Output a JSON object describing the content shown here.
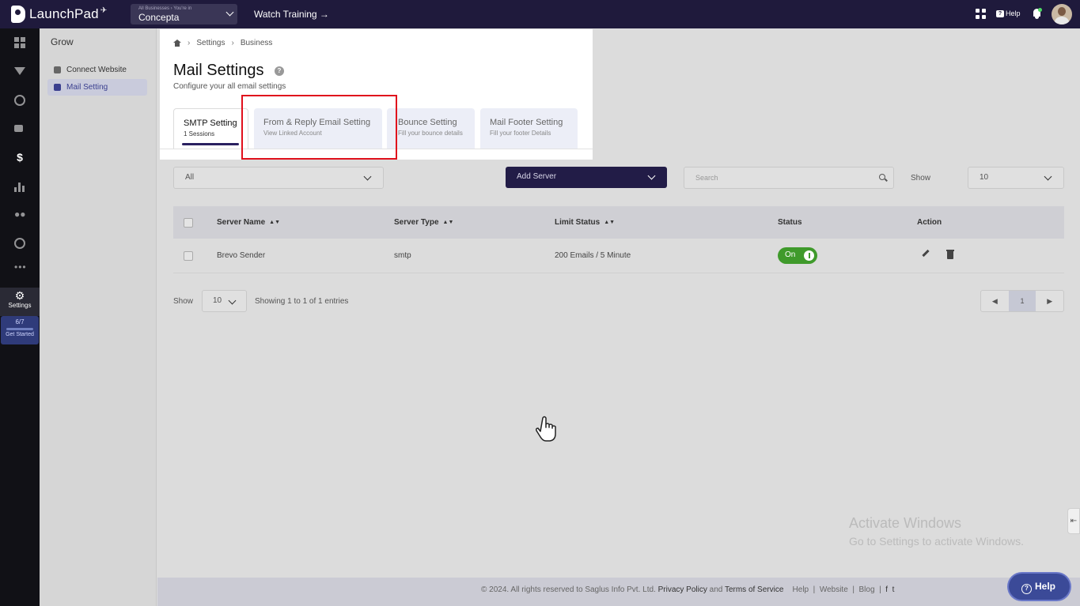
{
  "topbar": {
    "app_name": "LaunchPad",
    "business_caption": "All Businesses › You're in",
    "business_name": "Concepta",
    "watch_training": "Watch Training →",
    "help_label": "Help"
  },
  "rail": {
    "settings_label": "Settings",
    "progress": "6/7",
    "get_started": "Get Started"
  },
  "sidebar": {
    "title": "Grow",
    "items": [
      {
        "label": "Connect Website"
      },
      {
        "label": "Mail Setting"
      }
    ]
  },
  "header": {
    "breadcrumb": [
      "Settings",
      "Business"
    ],
    "title": "Mail Settings",
    "subtitle": "Configure your all email settings"
  },
  "tabs": [
    {
      "title": "SMTP Setting",
      "subtitle": "1 Sessions"
    },
    {
      "title": "From & Reply Email Setting",
      "subtitle": "View Linked Account"
    },
    {
      "title": "Bounce Setting",
      "subtitle": "Fill your bounce details"
    },
    {
      "title": "Mail Footer Setting",
      "subtitle": "Fill your footer Details"
    }
  ],
  "controls": {
    "filter_value": "All",
    "add_server": "Add Server",
    "search_placeholder": "Search",
    "show_label": "Show",
    "show_value": "10"
  },
  "table": {
    "headers": [
      "Server Name",
      "Server Type",
      "Limit Status",
      "Status",
      "Action"
    ],
    "rows": [
      {
        "server_name": "Brevo Sender",
        "server_type": "smtp",
        "limit_status": "200 Emails / 5 Minute",
        "status": "On"
      }
    ]
  },
  "pagination": {
    "show_label": "Show",
    "per_page": "10",
    "info": "Showing 1 to 1 of 1 entries",
    "prev": "◀",
    "current": "1",
    "next": "▶"
  },
  "watermark": {
    "line1": "Activate Windows",
    "line2": "Go to Settings to activate Windows."
  },
  "footer": {
    "copyright": "©  2024. All rights reserved to Saglus Info Pvt. Ltd.",
    "privacy": "Privacy Policy",
    "and": "and",
    "terms": "Terms of Service",
    "links": [
      "Help",
      "Website",
      "Blog"
    ],
    "social": [
      "f",
      "t"
    ]
  },
  "help_fab": {
    "label": "Help"
  },
  "colors": {
    "topbar": "#1f1a3c",
    "accent": "#221c47",
    "toggle_on": "#3f9a2b",
    "highlight_box": "#e0101c"
  }
}
